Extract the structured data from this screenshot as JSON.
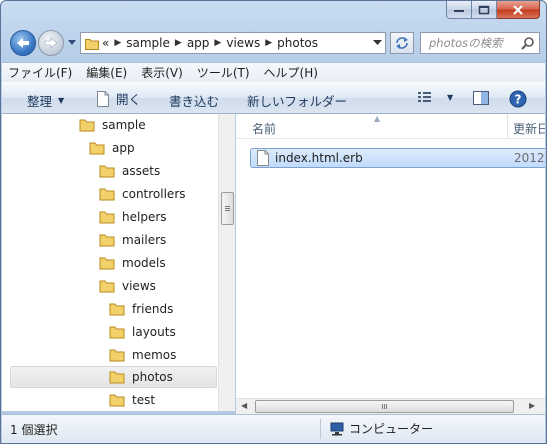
{
  "window": {
    "caption_buttons": [
      "minimize",
      "maximize",
      "close"
    ],
    "colors": {
      "frame": "#b9cfe9",
      "close_button": "#c9452a",
      "selection": "#cde4fc"
    }
  },
  "address": {
    "crumbs": [
      "sample",
      "app",
      "views",
      "photos"
    ],
    "overflow": "«"
  },
  "search": {
    "placeholder": "photosの検索"
  },
  "menubar": {
    "items": [
      "ファイル(F)",
      "編集(E)",
      "表示(V)",
      "ツール(T)",
      "ヘルプ(H)"
    ]
  },
  "toolbar": {
    "organize": "整理",
    "open": "開く",
    "write": "書き込む",
    "new_folder": "新しいフォルダー"
  },
  "tree": {
    "items": [
      {
        "label": "sample",
        "level": 0
      },
      {
        "label": "app",
        "level": 1
      },
      {
        "label": "assets",
        "level": 2
      },
      {
        "label": "controllers",
        "level": 2
      },
      {
        "label": "helpers",
        "level": 2
      },
      {
        "label": "mailers",
        "level": 2
      },
      {
        "label": "models",
        "level": 2
      },
      {
        "label": "views",
        "level": 2
      },
      {
        "label": "friends",
        "level": 3
      },
      {
        "label": "layouts",
        "level": 3
      },
      {
        "label": "memos",
        "level": 3
      },
      {
        "label": "photos",
        "level": 3,
        "selected": true
      },
      {
        "label": "test",
        "level": 3
      }
    ]
  },
  "columns": {
    "name": "名前",
    "date": "更新日"
  },
  "files": [
    {
      "name": "index.html.erb",
      "date": "2012"
    }
  ],
  "status": {
    "selection": "1 個選択",
    "location": "コンピューター"
  }
}
